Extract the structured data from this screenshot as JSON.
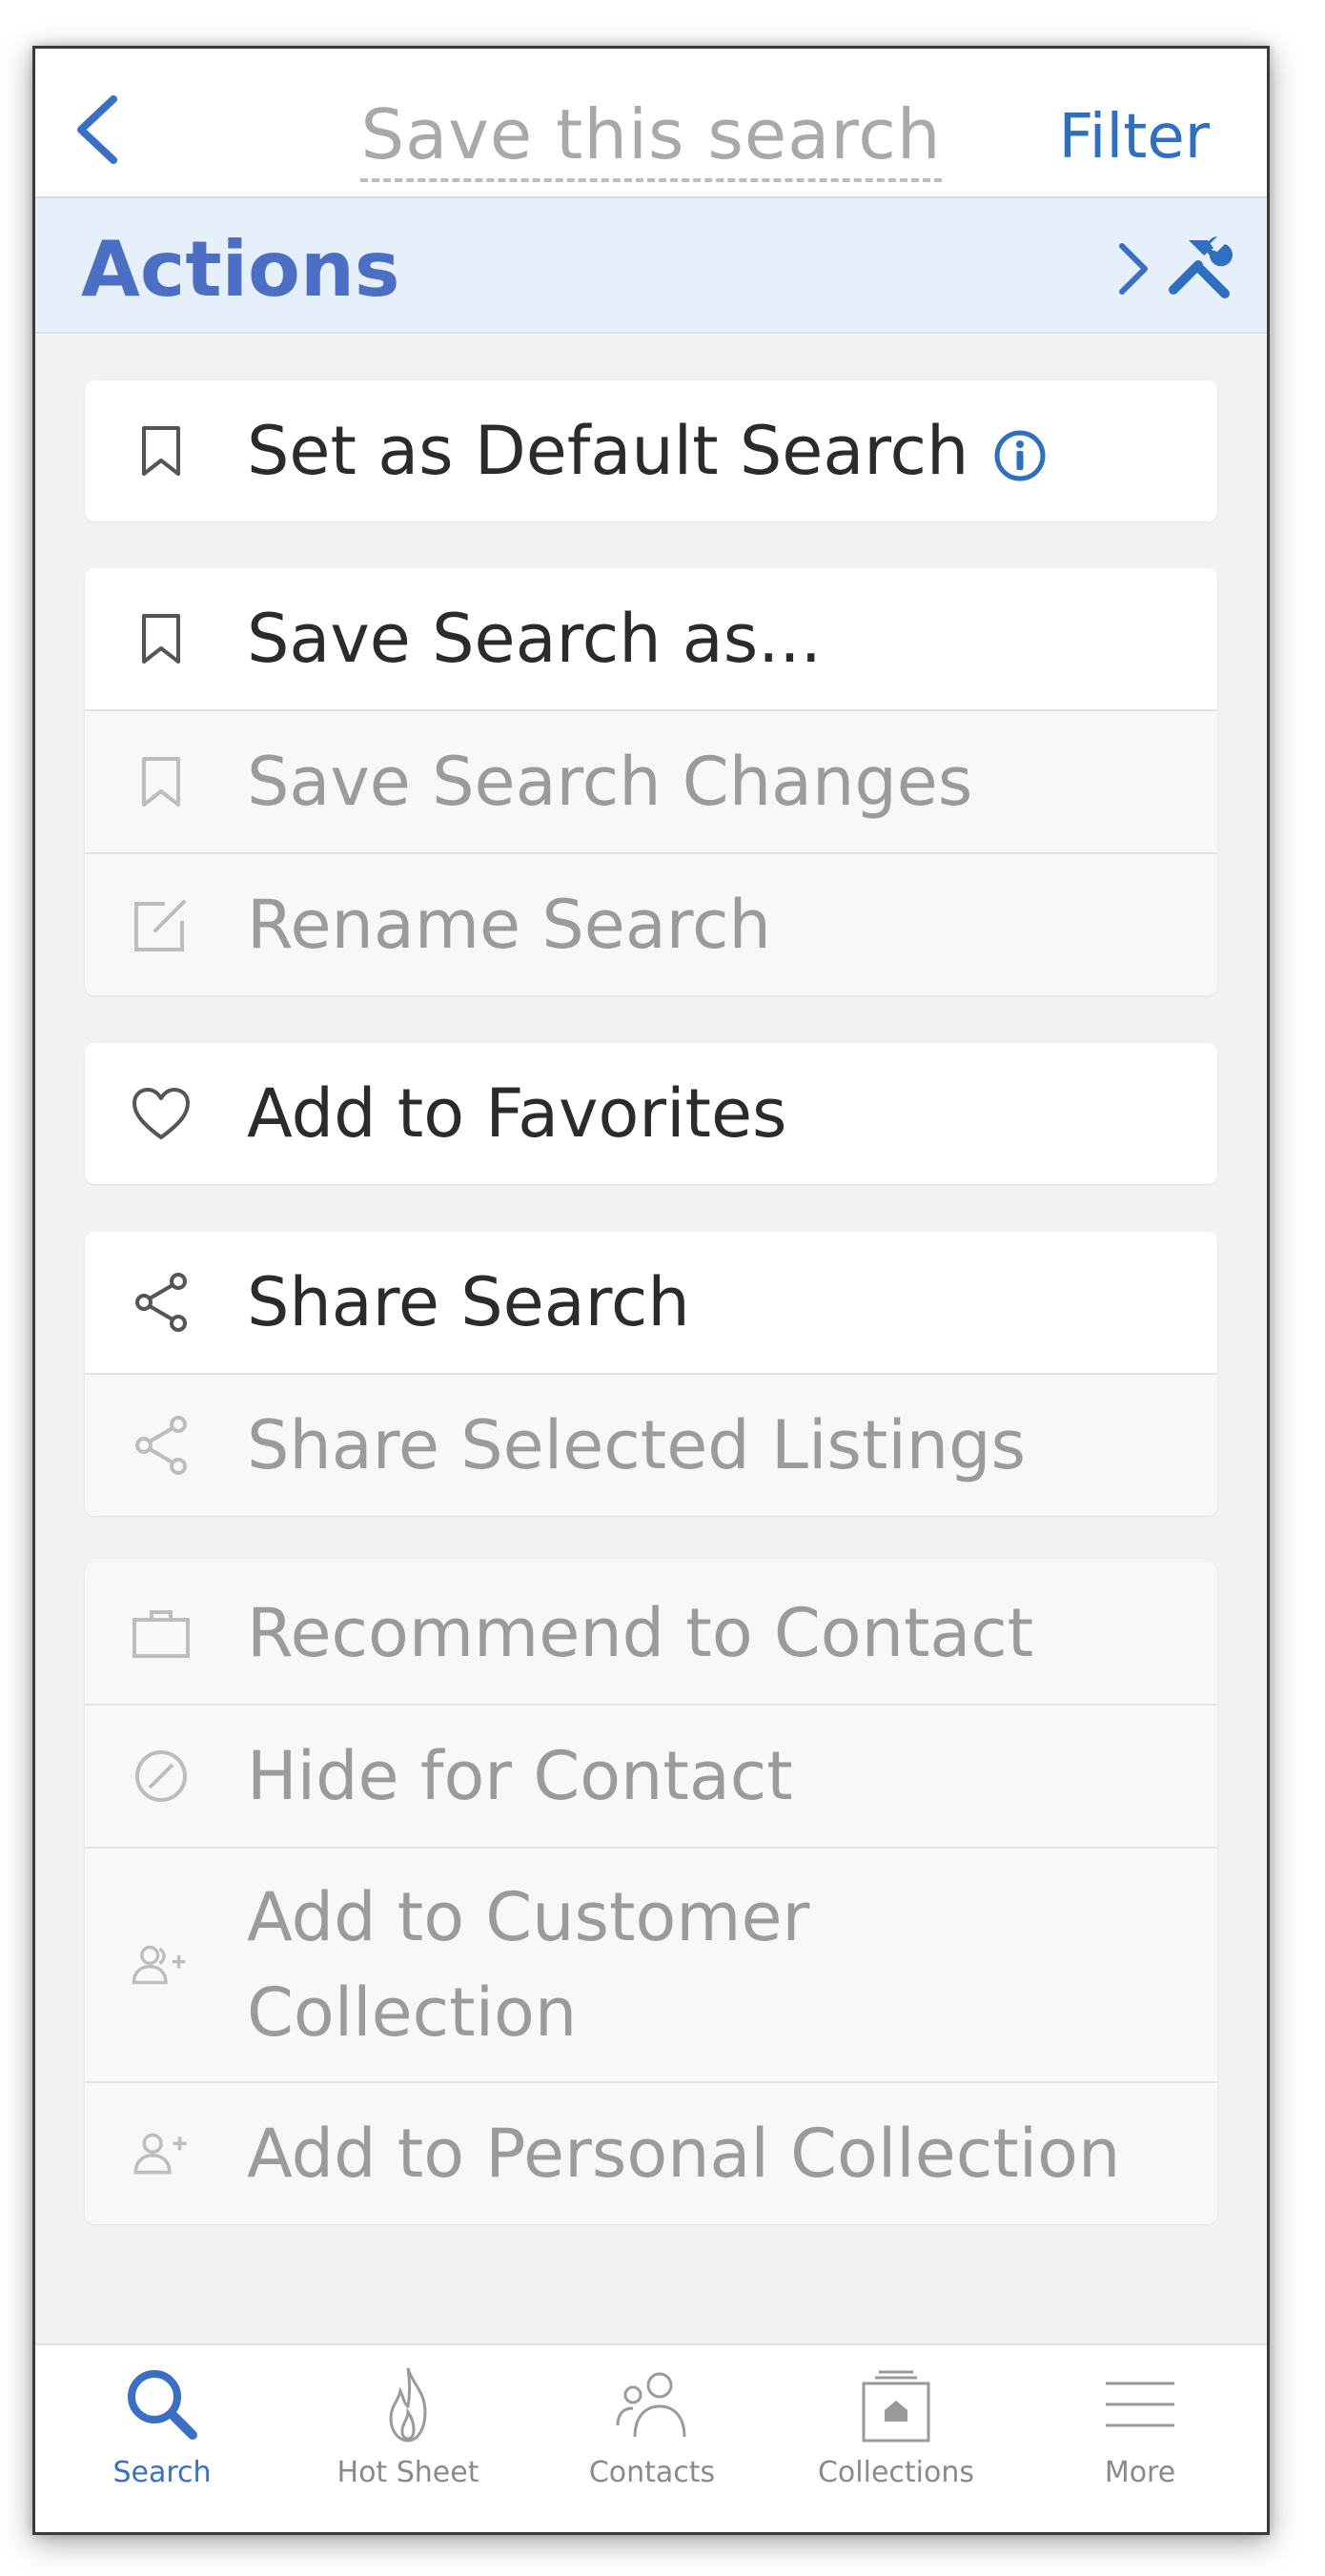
{
  "header": {
    "title": "Save this search",
    "filter_label": "Filter"
  },
  "actions_bar": {
    "title": "Actions"
  },
  "groups": [
    {
      "rows": [
        {
          "label": "Set as Default Search",
          "icon": "bookmark-icon",
          "enabled": true,
          "has_info": true
        }
      ]
    },
    {
      "rows": [
        {
          "label": "Save Search as...",
          "icon": "bookmark-icon",
          "enabled": true
        },
        {
          "label": "Save Search Changes",
          "icon": "bookmark-icon",
          "enabled": false
        },
        {
          "label": "Rename Search",
          "icon": "edit-icon",
          "enabled": false
        }
      ]
    },
    {
      "rows": [
        {
          "label": "Add to Favorites",
          "icon": "heart-icon",
          "enabled": true
        }
      ]
    },
    {
      "rows": [
        {
          "label": "Share Search",
          "icon": "share-icon",
          "enabled": true
        },
        {
          "label": "Share Selected Listings",
          "icon": "share-icon",
          "enabled": false
        }
      ]
    },
    {
      "rows": [
        {
          "label": "Recommend to Contact",
          "icon": "briefcase-icon",
          "enabled": false
        },
        {
          "label": "Hide for Contact",
          "icon": "block-icon",
          "enabled": false
        },
        {
          "label": "Add to Customer Collection",
          "icon": "add-users-icon",
          "enabled": false
        },
        {
          "label": "Add to Personal Collection",
          "icon": "add-user-icon",
          "enabled": false
        }
      ]
    }
  ],
  "tabs": [
    {
      "label": "Search",
      "icon": "search-icon",
      "active": true
    },
    {
      "label": "Hot Sheet",
      "icon": "flame-icon",
      "active": false
    },
    {
      "label": "Contacts",
      "icon": "contacts-icon",
      "active": false
    },
    {
      "label": "Collections",
      "icon": "collections-icon",
      "active": false
    },
    {
      "label": "More",
      "icon": "menu-icon",
      "active": false
    }
  ],
  "colors": {
    "accent": "#2f6fc2",
    "actions_bg": "#e5f0fb",
    "disabled_text": "#9b9b9b",
    "enabled_text": "#2b2b2b"
  }
}
